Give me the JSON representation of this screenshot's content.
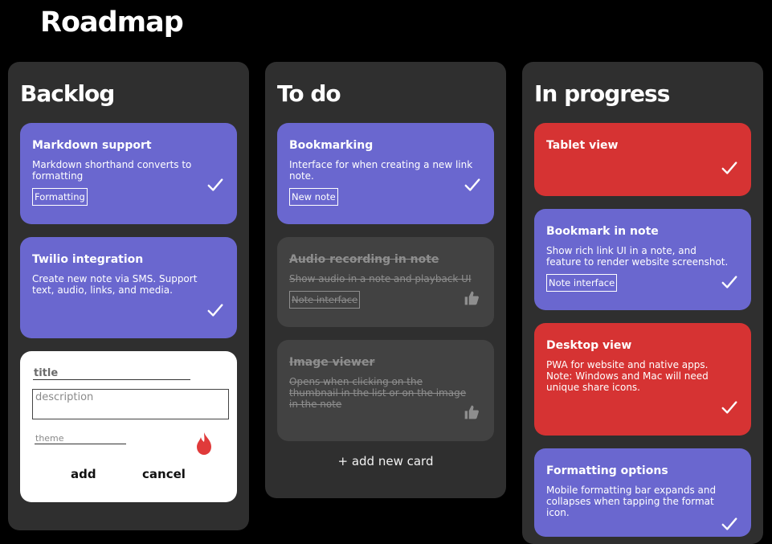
{
  "page": {
    "title": "Roadmap"
  },
  "colors": {
    "background": "#000000",
    "column": "#2f2f2f",
    "card_purple": "#6a67cf",
    "card_red": "#d63333",
    "card_done": "#424242",
    "flame": "#e03a3a"
  },
  "columns": {
    "backlog": {
      "title": "Backlog",
      "cards": [
        {
          "title": "Markdown support",
          "description": "Markdown shorthand converts to formatting",
          "tag": "Formatting",
          "icon": "check-icon"
        },
        {
          "title": "Twilio integration",
          "description": "Create new note via SMS. Support text, audio, links, and media.",
          "icon": "check-icon"
        }
      ],
      "form": {
        "title_placeholder": "title",
        "description_placeholder": "description",
        "theme_placeholder": "theme",
        "theme_icon": "flame-icon",
        "add_label": "add",
        "cancel_label": "cancel"
      }
    },
    "todo": {
      "title": "To do",
      "cards": [
        {
          "title": "Bookmarking",
          "description": "Interface for when creating a new link note.",
          "tag": "New note",
          "icon": "check-icon"
        },
        {
          "title": "Audio recording in note",
          "description": "Show audio in a note and playback UI",
          "tag": "Note interface",
          "icon": "thumbs-up-icon"
        },
        {
          "title": "Image viewer",
          "description": "Opens when clicking on the thumbnail in the list or on the image in the note",
          "icon": "thumbs-up-icon"
        }
      ],
      "add_new_label": "+ add new card"
    },
    "in_progress": {
      "title": "In progress",
      "cards": [
        {
          "title": "Tablet view",
          "icon": "check-icon"
        },
        {
          "title": "Bookmark in note",
          "description": "Show rich link UI in a note, and feature to render website screenshot.",
          "tag": "Note interface",
          "icon": "check-icon"
        },
        {
          "title": "Desktop view",
          "description": "PWA for website and native apps. Note: Windows and Mac will need unique share icons.",
          "icon": "check-icon"
        },
        {
          "title": "Formatting options",
          "description": "Mobile formatting bar expands and collapses when tapping the format icon.",
          "icon": "check-icon"
        }
      ]
    }
  }
}
